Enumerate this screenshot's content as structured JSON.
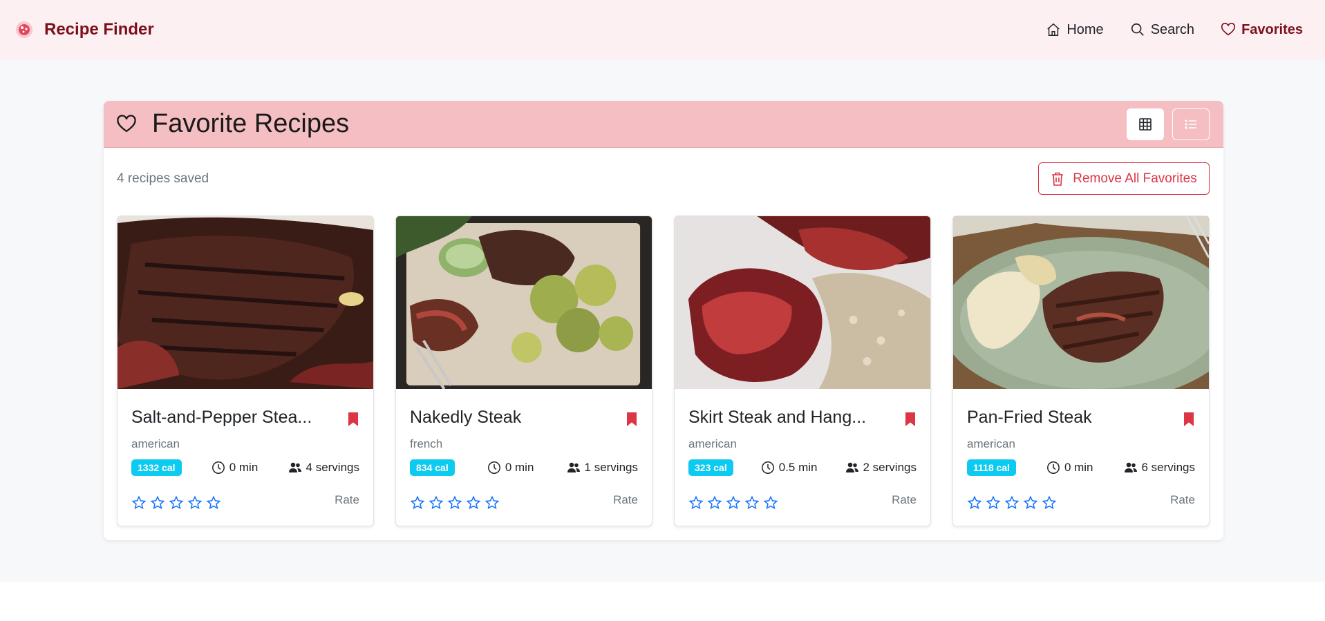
{
  "nav": {
    "brand": "Recipe Finder",
    "links": [
      {
        "label": "Home",
        "icon": "house-icon"
      },
      {
        "label": "Search",
        "icon": "search-icon"
      },
      {
        "label": "Favorites",
        "icon": "heart-icon",
        "active": true
      }
    ]
  },
  "favorites": {
    "title": "Favorite Recipes",
    "count_text": "4 recipes saved",
    "remove_all_label": "Remove All Favorites",
    "view_modes": [
      "grid-icon",
      "list-icon"
    ],
    "active_view": "grid"
  },
  "recipes": [
    {
      "title": "Salt-and-Pepper Stea...",
      "cuisine": "american",
      "calories": "1332 cal",
      "time": "0 min",
      "servings": "4 servings",
      "rating": 0,
      "rate_label": "Rate",
      "image": "grilled-skirt-steak-photo"
    },
    {
      "title": "Nakedly Steak",
      "cuisine": "french",
      "calories": "834 cal",
      "time": "0 min",
      "servings": "1 servings",
      "rating": 0,
      "rate_label": "Rate",
      "image": "steak-with-roasted-cauliflower-photo"
    },
    {
      "title": "Skirt Steak and Hang...",
      "cuisine": "american",
      "calories": "323 cal",
      "time": "0.5 min",
      "servings": "2 servings",
      "rating": 0,
      "rate_label": "Rate",
      "image": "sliced-steak-with-risotto-photo"
    },
    {
      "title": "Pan-Fried Steak",
      "cuisine": "american",
      "calories": "1118 cal",
      "time": "0 min",
      "servings": "6 servings",
      "rating": 0,
      "rate_label": "Rate",
      "image": "steak-with-chips-platter-photo"
    }
  ],
  "colors": {
    "brand": "#7d0f1a",
    "navbar_bg": "#fcf0f2",
    "header_bg": "#f4bec2",
    "danger": "#dc3545",
    "info": "#0dcaf0",
    "star": "#0d6efd"
  }
}
